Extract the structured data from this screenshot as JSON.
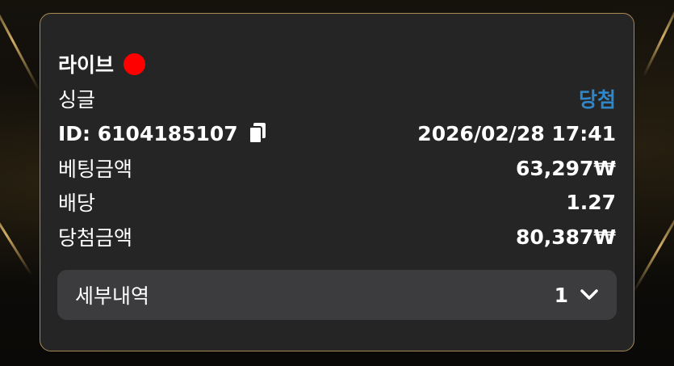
{
  "card": {
    "title": "라이브",
    "live_color": "#ff0000",
    "bet_type": "싱글",
    "result": "당첨",
    "result_color": "#2f86c8",
    "id_text": "ID: 6104185107",
    "datetime": "2026/02/28 17:41",
    "rows": [
      {
        "label": "베팅금액",
        "value": "63,297₩"
      },
      {
        "label": "배당",
        "value": "1.27"
      },
      {
        "label": "당첨금액",
        "value": "80,387₩"
      }
    ],
    "details": {
      "label": "세부내역",
      "count": "1"
    }
  },
  "icons": {
    "copy": "copy-icon",
    "chevron": "chevron-down-icon"
  },
  "colors": {
    "card_bg": "#252526",
    "border": "#a98a55",
    "details_bg": "#3c3c3f"
  }
}
